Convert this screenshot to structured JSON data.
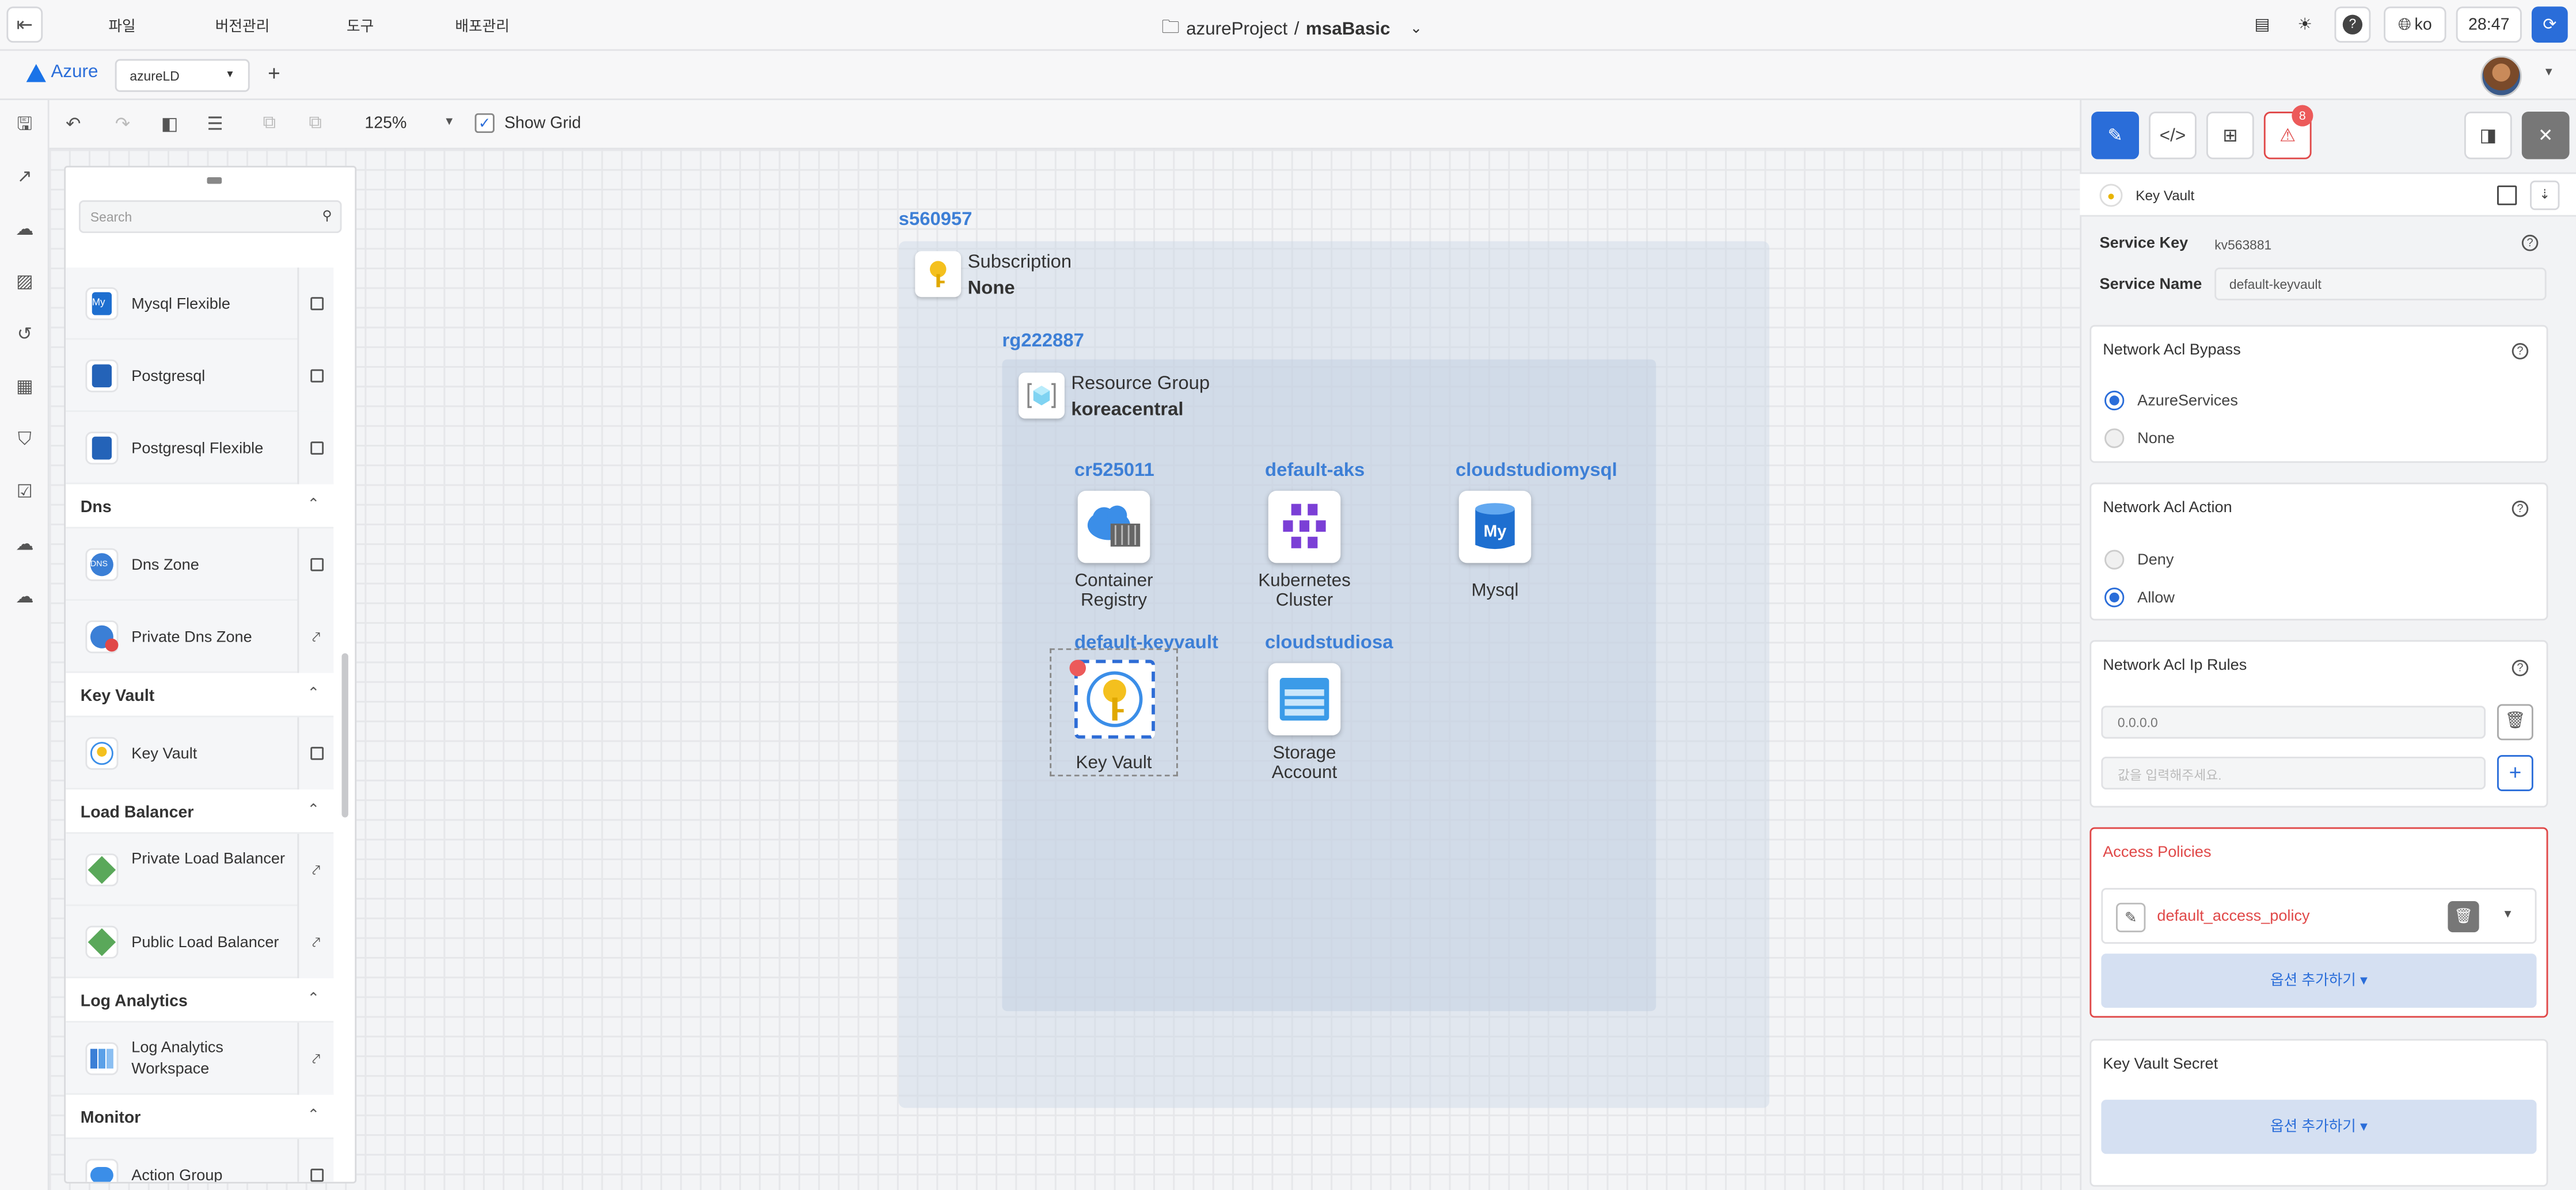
{
  "topbar": {
    "menus": [
      "파일",
      "버전관리",
      "도구",
      "배포관리"
    ],
    "project_name": "azureProject",
    "separator": " / ",
    "app_name": "msaBasic",
    "language": "ko",
    "timer": "28:47"
  },
  "bar2": {
    "logo_text": "Azure",
    "workspace_select": "azureLD"
  },
  "toolbar": {
    "zoom": "125%",
    "show_grid_label": "Show Grid",
    "show_grid_checked": true
  },
  "palette": {
    "search_placeholder": "Search",
    "items": [
      {
        "type": "item",
        "label": "Mysql Flexible",
        "action": "checkbox",
        "icon": "mysql-icon"
      },
      {
        "type": "item",
        "label": "Postgresql",
        "action": "checkbox",
        "icon": "postgresql-icon"
      },
      {
        "type": "item",
        "label": "Postgresql Flexible",
        "action": "checkbox",
        "icon": "postgresql-icon"
      },
      {
        "type": "header",
        "label": "Dns"
      },
      {
        "type": "item",
        "label": "Dns Zone",
        "action": "checkbox",
        "icon": "dns-icon"
      },
      {
        "type": "item",
        "label": "Private Dns Zone",
        "action": "link",
        "icon": "private-dns-icon"
      },
      {
        "type": "header",
        "label": "Key Vault"
      },
      {
        "type": "item",
        "label": "Key Vault",
        "action": "checkbox",
        "icon": "key-vault-icon"
      },
      {
        "type": "header",
        "label": "Load Balancer"
      },
      {
        "type": "item",
        "label": "Private Load Balancer",
        "action": "link",
        "icon": "load-balancer-icon"
      },
      {
        "type": "item",
        "label": "Public Load Balancer",
        "action": "link",
        "icon": "load-balancer-icon"
      },
      {
        "type": "header",
        "label": "Log Analytics"
      },
      {
        "type": "item",
        "label": "Log Analytics Workspace",
        "action": "link",
        "icon": "log-analytics-icon"
      },
      {
        "type": "header",
        "label": "Monitor"
      },
      {
        "type": "item",
        "label": "Action Group",
        "action": "checkbox",
        "icon": "action-group-icon"
      }
    ]
  },
  "diagram": {
    "subscription": {
      "id": "s560957",
      "title": "Subscription",
      "value": "None"
    },
    "resource_group": {
      "id": "rg222887",
      "title": "Resource Group",
      "value": "koreacentral"
    },
    "nodes": [
      {
        "id": "cr525011",
        "label_line1": "Container",
        "label_line2": "Registry"
      },
      {
        "id": "default-aks",
        "label_line1": "Kubernetes",
        "label_line2": "Cluster"
      },
      {
        "id": "cloudstudiomysql",
        "label_line1": "Mysql",
        "label_line2": ""
      },
      {
        "id": "default-keyvault",
        "label_line1": "Key Vault",
        "label_line2": ""
      },
      {
        "id": "cloudstudiosa",
        "label_line1": "Storage",
        "label_line2": "Account"
      }
    ]
  },
  "inspector": {
    "warning_count": "8",
    "title": "Key Vault",
    "service_key_label": "Service Key",
    "service_key_value": "kv563881",
    "service_name_label": "Service Name",
    "service_name_value": "default-keyvault",
    "bypass": {
      "title": "Network Acl Bypass",
      "options": [
        "AzureServices",
        "None"
      ],
      "selected": "AzureServices"
    },
    "action": {
      "title": "Network Acl Action",
      "options": [
        "Deny",
        "Allow"
      ],
      "selected": "Allow"
    },
    "ip_rules": {
      "title": "Network Acl Ip Rules",
      "value": "0.0.0.0",
      "placeholder": "값을 입력해주세요."
    },
    "access_policies": {
      "title": "Access Policies",
      "policy": "default_access_policy",
      "add_label": "옵션 추가하기"
    },
    "kv_secret": {
      "title": "Key Vault Secret",
      "add_label": "옵션 추가하기"
    }
  }
}
